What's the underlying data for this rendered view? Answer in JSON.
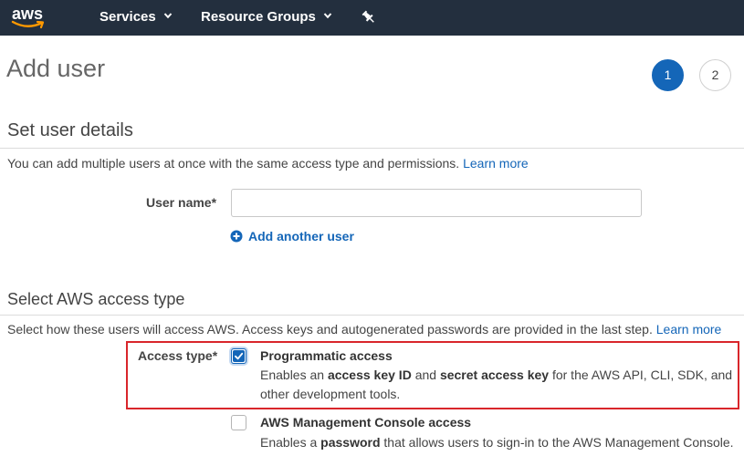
{
  "topnav": {
    "logo_text": "aws",
    "items": [
      {
        "label": "Services"
      },
      {
        "label": "Resource Groups"
      }
    ],
    "pin_icon": "pushpin-icon"
  },
  "page": {
    "title": "Add user",
    "steps": [
      {
        "label": "1",
        "state": "active"
      },
      {
        "label": "2",
        "state": "inactive"
      }
    ]
  },
  "user_details": {
    "heading": "Set user details",
    "description": "You can add multiple users at once with the same access type and permissions.",
    "learn_more": "Learn more",
    "user_name_label": "User name*",
    "user_name_value": "",
    "add_another": "Add another user"
  },
  "access_type": {
    "heading": "Select AWS access type",
    "description": "Select how these users will access AWS. Access keys and autogenerated passwords are provided in the last step.",
    "learn_more": "Learn more",
    "label": "Access type*",
    "options": [
      {
        "title": "Programmatic access",
        "checked": true,
        "desc_prefix": "Enables an ",
        "desc_bold1": "access key ID",
        "desc_mid": " and ",
        "desc_bold2": "secret access key",
        "desc_suffix": " for the AWS API, CLI, SDK, and other development tools."
      },
      {
        "title": "AWS Management Console access",
        "checked": false,
        "desc_prefix": "Enables a ",
        "desc_bold1": "password",
        "desc_suffix": " that allows users to sign-in to the AWS Management Console."
      }
    ]
  },
  "colors": {
    "nav_bg": "#232f3e",
    "accent_blue": "#1466b8",
    "highlight_red": "#d9262b"
  }
}
